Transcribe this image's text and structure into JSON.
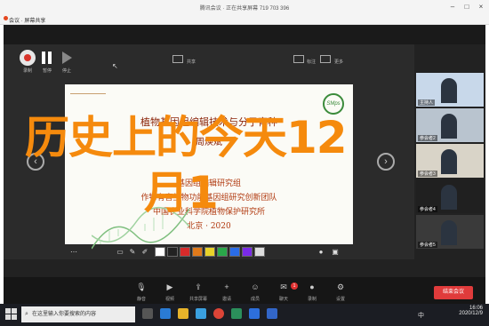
{
  "window": {
    "title": "腾讯会议 · 正在共享屏幕",
    "tab_title": "会议 · 屏幕共享",
    "ids": "719 703 396"
  },
  "recording": {
    "rec_label": "录制",
    "pause_label": "暂停",
    "stop_label": "停止"
  },
  "topbar": {
    "mid_label": "共享",
    "right_labels": [
      "标注",
      "更多"
    ]
  },
  "slide": {
    "title": "植物基因组编辑技术与分子育种",
    "presenter": "周焕斌",
    "org_lines": [
      "基因组编辑研究组",
      "作物有害生物功能基因组研究创新团队",
      "中国农业科学院植物保护研究所"
    ],
    "date": "北京 · 2020",
    "logo_text": "SMps"
  },
  "overlay": {
    "line1": "历史上的今天12",
    "line2": "月1"
  },
  "annotation_colors": [
    "#ffffff",
    "#222222",
    "#d72b2b",
    "#e07a1a",
    "#e8d22a",
    "#2aa84a",
    "#2a6de8",
    "#7a2ae8",
    "#dddddd"
  ],
  "participants": [
    {
      "label": "主持人",
      "bg": "#c8d8ea"
    },
    {
      "label": "参会者2",
      "bg": "#b9c4cf"
    },
    {
      "label": "参会者3",
      "bg": "#d9d4c8"
    },
    {
      "label": "参会者4",
      "bg": "#202020"
    },
    {
      "label": "参会者5",
      "bg": "#3a3a3a"
    }
  ],
  "bottom_tools": [
    {
      "icon": "mic-icon",
      "label": "静音"
    },
    {
      "icon": "video-icon",
      "label": "视频"
    },
    {
      "icon": "share-icon",
      "label": "共享屏幕"
    },
    {
      "icon": "invite-icon",
      "label": "邀请"
    },
    {
      "icon": "members-icon",
      "label": "成员"
    },
    {
      "icon": "chat-icon",
      "label": "聊天"
    },
    {
      "icon": "record-icon",
      "label": "录制"
    },
    {
      "icon": "settings-icon",
      "label": "设置"
    }
  ],
  "chat_badge": "1",
  "end_button": "结束会议",
  "taskbar": {
    "search_placeholder": "在这里输入你要搜索的内容",
    "time": "16:06",
    "date": "2020/12/9",
    "ime": "中"
  }
}
